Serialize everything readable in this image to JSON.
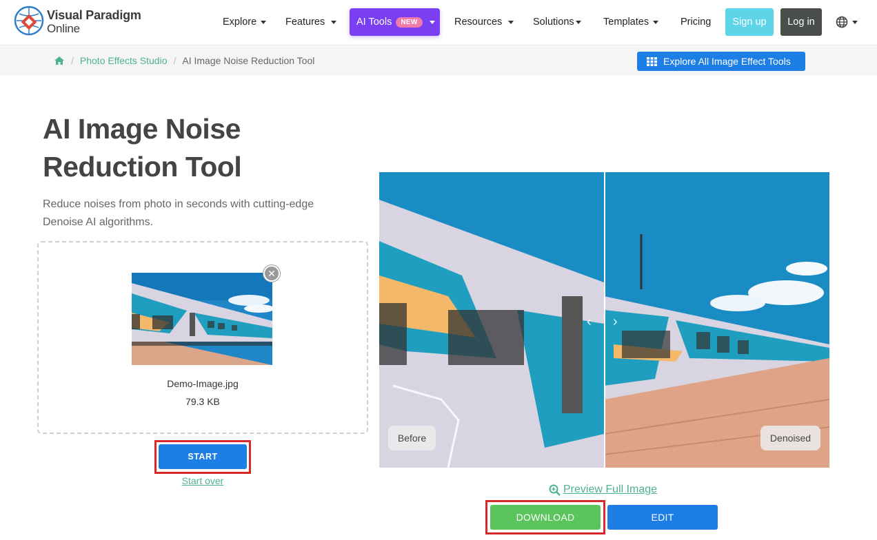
{
  "brand": {
    "line1": "Visual Paradigm",
    "line2": "Online"
  },
  "nav": {
    "items": [
      {
        "label": "Explore",
        "caret": true
      },
      {
        "label": "Features",
        "caret": true
      },
      {
        "label": "Resources",
        "caret": true
      },
      {
        "label": "Solutions",
        "caret": true
      },
      {
        "label": "Templates",
        "caret": true
      },
      {
        "label": "Pricing",
        "caret": false
      }
    ],
    "ai_tools": {
      "label": "AI Tools",
      "badge": "NEW"
    },
    "signup": "Sign up",
    "login": "Log in"
  },
  "breadcrumb": {
    "items": [
      "Photo Effects Studio",
      "AI Image Noise Reduction Tool"
    ],
    "explore_all": "Explore All Image Effect Tools"
  },
  "hero": {
    "title_line1": "AI Image Noise",
    "title_line2": "Reduction Tool",
    "subtitle": "Reduce noises from photo in seconds with cutting-edge Denoise AI algorithms."
  },
  "upload": {
    "file_name": "Demo-Image.jpg",
    "file_size": "79.3 KB",
    "start": "START",
    "start_over": "Start over"
  },
  "compare": {
    "before": "Before",
    "after": "Denoised",
    "divider_fraction": 0.5
  },
  "actions": {
    "preview": "Preview Full Image",
    "download": "DOWNLOAD",
    "edit": "EDIT"
  },
  "colors": {
    "accent_blue": "#1d7ee6",
    "ai_purple": "#7a3ff2",
    "link_green": "#4db38a",
    "download_green": "#5cc45c",
    "highlight_red": "#d62a2a"
  }
}
